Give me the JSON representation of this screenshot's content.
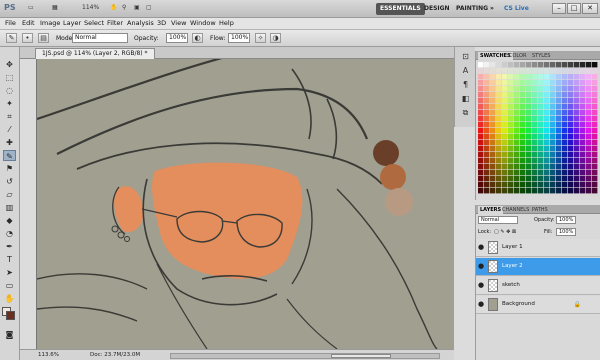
{
  "app": {
    "logo": "PS",
    "zoom": "114%"
  },
  "workspace": {
    "essentials": "ESSENTIALS",
    "design": "DESIGN",
    "painting": "PAINTING",
    "more": "»",
    "cslive": "CS Live"
  },
  "menu": [
    "File",
    "Edit",
    "Image",
    "Layer",
    "Select",
    "Filter",
    "Analysis",
    "3D",
    "View",
    "Window",
    "Help"
  ],
  "options": {
    "mode_label": "Mode:",
    "mode_value": "Normal",
    "opacity_label": "Opacity:",
    "opacity_value": "100%",
    "flow_label": "Flow:",
    "flow_value": "100%"
  },
  "document": {
    "tab_title": "1JS.psd @ 114% (Layer 2, RGB/8) *",
    "zoom_status": "113.6%",
    "doc_size": "Doc: 23.7M/23.0M"
  },
  "panels": {
    "swatches_tabs": [
      "SWATCHES",
      "COLOR",
      "STYLES"
    ],
    "layers_tabs": [
      "LAYERS",
      "CHANNELS",
      "PATHS"
    ],
    "blend_mode": "Normal",
    "opacity_label": "Opacity:",
    "opacity_value": "100%",
    "lock_label": "Lock:",
    "fill_label": "Fill:",
    "fill_value": "100%"
  },
  "layers": [
    {
      "name": "Layer 1",
      "selected": false,
      "background": false
    },
    {
      "name": "Layer 2",
      "selected": true,
      "background": false
    },
    {
      "name": "sketch",
      "selected": false,
      "background": false
    },
    {
      "name": "Background",
      "selected": false,
      "background": true
    }
  ],
  "colors": {
    "accent": "#3d9be9",
    "canvas": "#a19f90",
    "skin": "#f08a55",
    "swatch_dark": "#6a3f2a",
    "swatch_mid": "#b06a40",
    "swatch_light": "#b89a82"
  }
}
